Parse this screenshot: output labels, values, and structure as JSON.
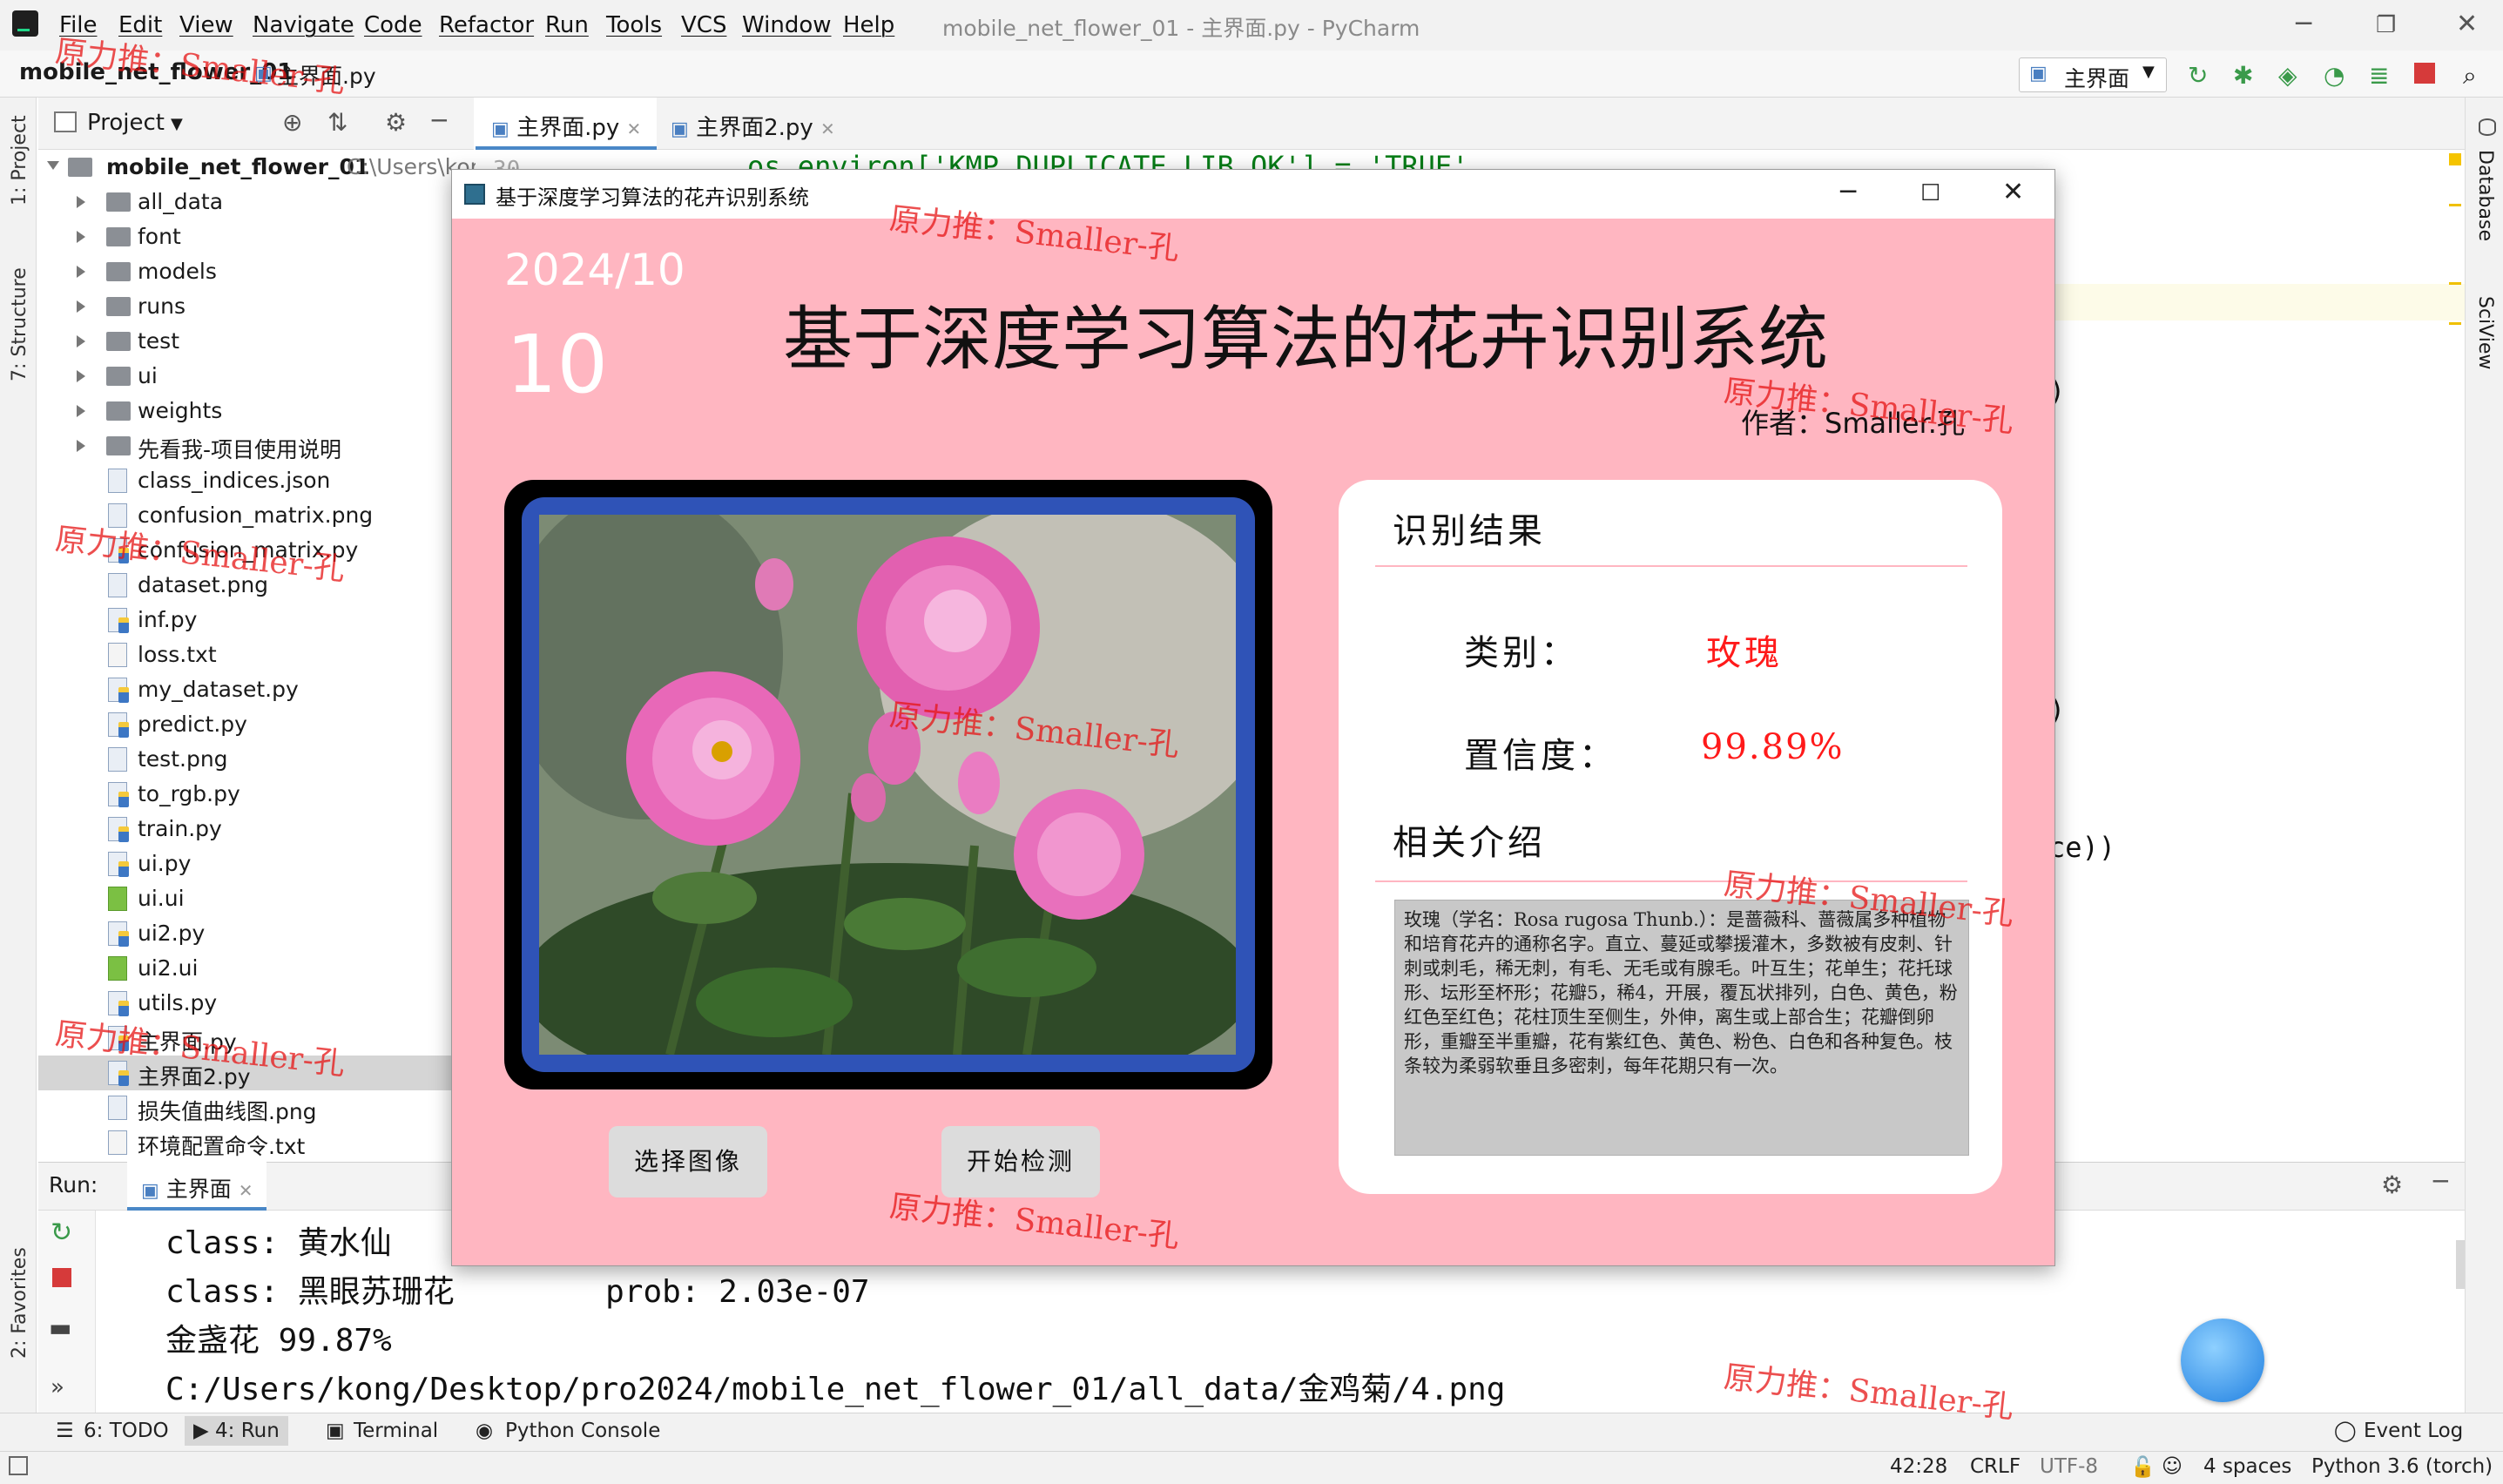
{
  "menu": {
    "items": [
      "File",
      "Edit",
      "View",
      "Navigate",
      "Code",
      "Refactor",
      "Run",
      "Tools",
      "VCS",
      "Window",
      "Help"
    ],
    "window_title": "mobile_net_flower_01 - 主界面.py - PyCharm"
  },
  "breadcrumb": {
    "project": "mobile_net_flower_01",
    "file": "主界面.py"
  },
  "toolbar": {
    "run_config": "主界面"
  },
  "side_tabs": {
    "project": "1: Project",
    "structure": "7: Structure",
    "favorites": "2: Favorites",
    "database": "Database",
    "sciview": "SciView"
  },
  "project_panel": {
    "title": "Project",
    "root": "mobile_net_flower_01",
    "root_path": "C:\\Users\\kor",
    "folders": [
      "all_data",
      "font",
      "models",
      "runs",
      "test",
      "ui",
      "weights",
      "先看我-项目使用说明"
    ],
    "files": [
      {
        "name": "class_indices.json",
        "type": "json"
      },
      {
        "name": "confusion_matrix.png",
        "type": "png"
      },
      {
        "name": "confusion_matrix.py",
        "type": "py"
      },
      {
        "name": "dataset.png",
        "type": "png"
      },
      {
        "name": "inf.py",
        "type": "py"
      },
      {
        "name": "loss.txt",
        "type": "txt"
      },
      {
        "name": "my_dataset.py",
        "type": "py"
      },
      {
        "name": "predict.py",
        "type": "py"
      },
      {
        "name": "test.png",
        "type": "png"
      },
      {
        "name": "to_rgb.py",
        "type": "py"
      },
      {
        "name": "train.py",
        "type": "py"
      },
      {
        "name": "ui.py",
        "type": "py"
      },
      {
        "name": "ui.ui",
        "type": "ui"
      },
      {
        "name": "ui2.py",
        "type": "py"
      },
      {
        "name": "ui2.ui",
        "type": "ui"
      },
      {
        "name": "utils.py",
        "type": "py"
      },
      {
        "name": "主界面.py",
        "type": "py"
      },
      {
        "name": "主界面2.py",
        "type": "py",
        "selected": true
      },
      {
        "name": "损失值曲线图.png",
        "type": "png"
      },
      {
        "name": "环境配置命令.txt",
        "type": "txt"
      }
    ]
  },
  "editor": {
    "tabs": [
      "主界面.py",
      "主界面2.py"
    ],
    "line_number": "30",
    "code_fragments": [
      "os.environ['KMP_DUPLICATE_LIB_OK'] = 'TRUE'",
      ")",
      ")",
      "ce))"
    ]
  },
  "run_panel": {
    "label": "Run:",
    "tab": "主界面",
    "lines": [
      "class: 黄水仙",
      "class: 黑眼苏珊花        prob: 2.03e-07",
      "金盏花 99.87%",
      "C:/Users/kong/Desktop/pro2024/mobile_net_flower_01/all_data/金鸡菊/4.png"
    ]
  },
  "bottom_tabs": [
    "6: TODO",
    "4: Run",
    "Terminal",
    "Python Console"
  ],
  "event_log": "Event Log",
  "status": {
    "position": "42:28",
    "line_sep": "CRLF",
    "encoding": "UTF-8",
    "indent": "4 spaces",
    "interpreter": "Python 3.6 (torch)"
  },
  "app": {
    "window_title": "基于深度学习算法的花卉识别系统",
    "date": "2024/10",
    "day": "10",
    "title": "基于深度学习算法的花卉识别系统",
    "author": "作者：Smaller.孔",
    "result_heading": "识别结果",
    "class_label": "类别：",
    "class_value": "玫瑰",
    "confidence_label": "置信度：",
    "confidence_value": "99.89%",
    "intro_heading": "相关介绍",
    "intro_text": "玫瑰（学名：Rosa rugosa Thunb.）：是蔷薇科、蔷薇属多种植物和培育花卉的通称名字。直立、蔓延或攀援灌木，多数被有皮刺、针刺或刺毛，稀无刺，有毛、无毛或有腺毛。叶互生；花单生；花托球形、坛形至杯形；花瓣5，稀4，开展，覆瓦状排列，白色、黄色，粉红色至红色；花柱顶生至侧生，外伸，离生或上部合生；花瓣倒卵形，重瓣至半重瓣，花有紫红色、黄色、粉色、白色和各种复色。枝条较为柔弱软垂且多密刺，每年花期只有一次。",
    "btn_select": "选择图像",
    "btn_detect": "开始检测",
    "colors": {
      "background": "#ffb6c1",
      "result_value": "#ff1a1a",
      "image_border": "#2f53b7"
    }
  },
  "watermark": "原力推：Smaller-孔"
}
